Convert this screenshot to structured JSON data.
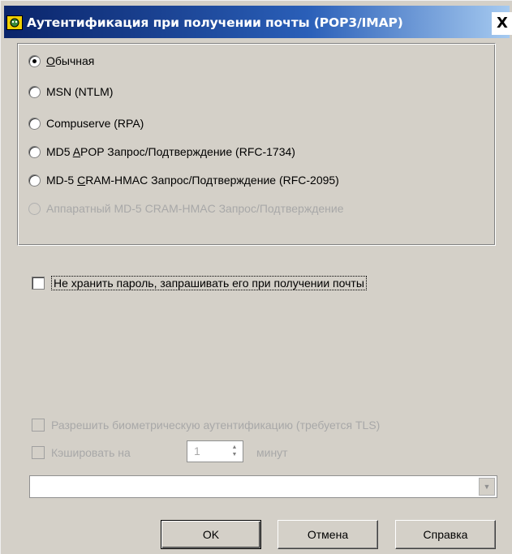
{
  "window": {
    "title": "Аутентификация при получении почты (POP3/IMAP)",
    "close_label": "X"
  },
  "auth_methods": [
    {
      "label": "Обычная",
      "checked": true,
      "disabled": false
    },
    {
      "label": "MSN (NTLM)",
      "checked": false,
      "disabled": false
    },
    {
      "label": "Compuserve (RPA)",
      "checked": false,
      "disabled": false
    },
    {
      "label": "MD5 APOP Запрос/Подтверждение (RFC-1734)",
      "checked": false,
      "disabled": false
    },
    {
      "label": "MD-5 CRAM-HMAC Запрос/Подтверждение (RFC-2095)",
      "checked": false,
      "disabled": false
    },
    {
      "label": "Аппаратный MD-5 CRAM-HMAC Запрос/Подтверждение",
      "checked": false,
      "disabled": true
    }
  ],
  "options": {
    "no_store_password": "Не хранить пароль, запрашивать его при получении почты",
    "allow_biometric": "Разрешить биометрическую аутентификацию (требуется TLS)",
    "cache_for": "Кэшировать на",
    "cache_minutes_value": "1",
    "minutes_label": "минут",
    "combo_value": ""
  },
  "buttons": {
    "ok": "OK",
    "cancel": "Отмена",
    "help": "Справка"
  },
  "colors": {
    "titlebar_start": "#0a246a",
    "titlebar_end": "#a6caf0",
    "dialog_bg": "#d4d0c8",
    "disabled_text": "#a8a8a8"
  }
}
